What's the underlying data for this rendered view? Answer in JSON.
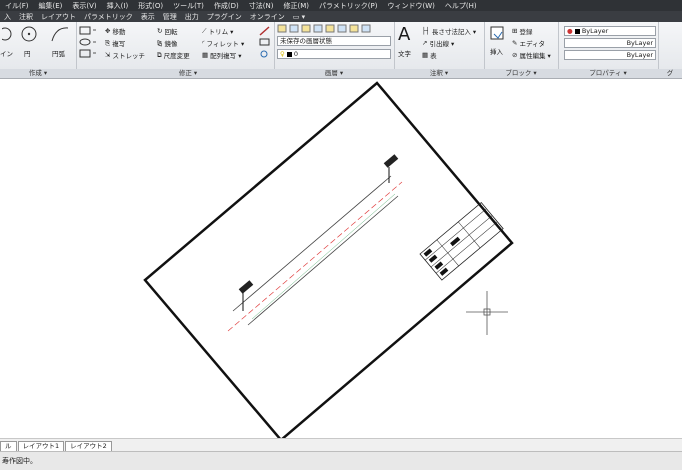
{
  "menubar": [
    "イル(F)",
    "編集(E)",
    "表示(V)",
    "挿入(I)",
    "形式(O)",
    "ツール(T)",
    "作成(D)",
    "寸法(N)",
    "修正(M)",
    "パラメトリック(P)",
    "ウィンドウ(W)",
    "ヘルプ(H)"
  ],
  "ribbon_tabs": [
    {
      "label": "入"
    },
    {
      "label": "注釈"
    },
    {
      "label": "レイアウト"
    },
    {
      "label": "パラメトリック"
    },
    {
      "label": "表示"
    },
    {
      "label": "管理"
    },
    {
      "label": "出力"
    },
    {
      "label": "プラグイン"
    },
    {
      "label": "オンライン"
    },
    {
      "label": "▭ ▾"
    }
  ],
  "draw_panel": {
    "title": "作成 ▾",
    "line_label": "イン",
    "circle_label": "円",
    "arc_label": "円弧"
  },
  "modify_panel": {
    "title": "修正 ▾",
    "move": "移動",
    "rotate": "回転",
    "trim": "トリム ▾",
    "copy": "複写",
    "mirror": "鏡像",
    "fillet": "フィレット ▾",
    "stretch": "ストレッチ",
    "scale": "尺度変更",
    "array": "配列複写 ▾"
  },
  "layers_panel": {
    "title": "画層 ▾",
    "layer_state": "未保存の画層状態",
    "current_layer": "0"
  },
  "annotation_panel": {
    "title": "注釈 ▾",
    "text_label": "文字",
    "dim": "長さ寸法記入 ▾",
    "leader": "引出線 ▾",
    "table": "表"
  },
  "block_panel": {
    "title": "ブロック ▾",
    "insert": "挿入",
    "create": "登録",
    "edit": "エディタ",
    "attr": "属性編集 ▾"
  },
  "properties_panel": {
    "title": "プロパティ ▾",
    "color": "ByLayer",
    "linetype": "ByLayer",
    "lineweight": "ByLayer"
  },
  "group_panel": {
    "title": "グ"
  },
  "layout_tabs": [
    "ル",
    "レイアウト1",
    "レイアウト2"
  ],
  "command_line": {
    "text": "寿作図中。"
  },
  "drawing": {
    "label_top": "██████",
    "label_bottom": "██████"
  },
  "colors": {
    "menubar_bg": "#2f3236",
    "ribbon_bg": "#e8eaed",
    "centerline": "#e04040",
    "frame": "#111111"
  }
}
